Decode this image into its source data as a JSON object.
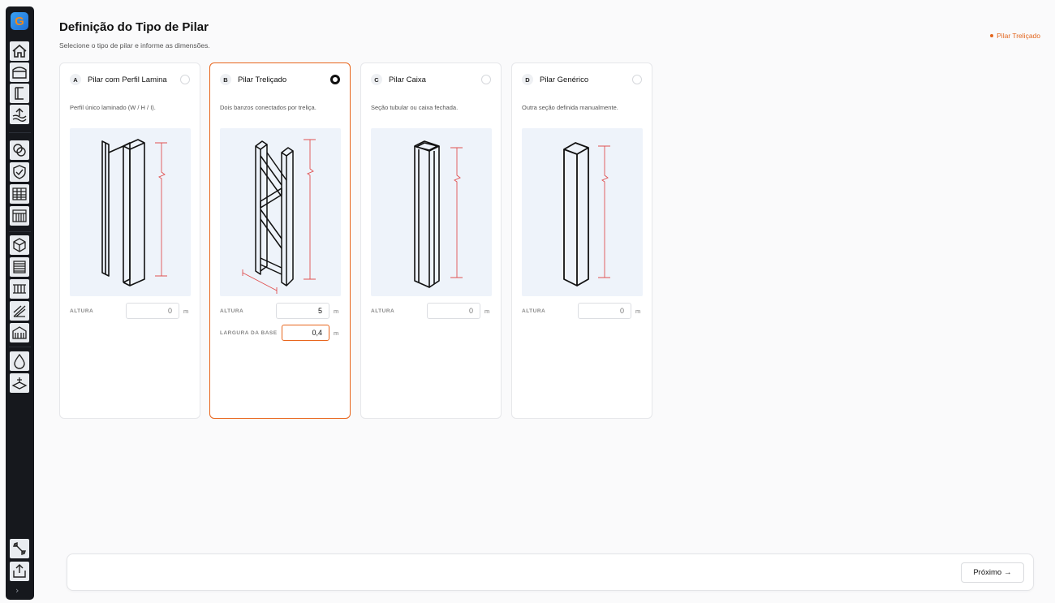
{
  "app": {
    "logo_letter": "G"
  },
  "sidebar": {
    "icons": [
      "home-icon",
      "warehouse-icon",
      "profile-section-icon",
      "upload-terrain-icon",
      "materials-icon",
      "shield-check-icon",
      "table-grid-icon",
      "table-list-icon",
      "cube-icon",
      "list-lines-icon",
      "grid-frame-icon",
      "stair-icon",
      "building-icon",
      "water-drop-icon",
      "foundation-icon",
      "wrench-icon",
      "export-icon"
    ],
    "expand_label": "›"
  },
  "header": {
    "title": "Definição do Tipo de Pilar",
    "subtitle": "Selecione o tipo de pilar e informe as dimensões.",
    "selected_label": "Pilar Treliçado"
  },
  "cards": [
    {
      "letter": "A",
      "title": "Pilar com Perfil Lamina",
      "description": "Perfil único laminado (W / H / I).",
      "selected": false,
      "fields": [
        {
          "label": "ALTURA",
          "value": "0",
          "unit": "m"
        }
      ]
    },
    {
      "letter": "B",
      "title": "Pilar Treliçado",
      "description": "Dois banzos conectados por treliça.",
      "selected": true,
      "fields": [
        {
          "label": "ALTURA",
          "value": "5",
          "unit": "m"
        },
        {
          "label": "LARGURA DA BASE",
          "value": "0,4",
          "unit": "m"
        }
      ]
    },
    {
      "letter": "C",
      "title": "Pilar Caixa",
      "description": "Seção tubular ou caixa fechada.",
      "selected": false,
      "fields": [
        {
          "label": "ALTURA",
          "value": "0",
          "unit": "m"
        }
      ]
    },
    {
      "letter": "D",
      "title": "Pilar Genérico",
      "description": "Outra seção definida manualmente.",
      "selected": false,
      "fields": [
        {
          "label": "ALTURA",
          "value": "0",
          "unit": "m"
        }
      ]
    }
  ],
  "footer": {
    "next_label": "Próximo",
    "next_arrow": "→"
  },
  "colors": {
    "accent": "#e8651c",
    "sidebar_bg": "#16181d",
    "dimension_line": "#e05050"
  }
}
